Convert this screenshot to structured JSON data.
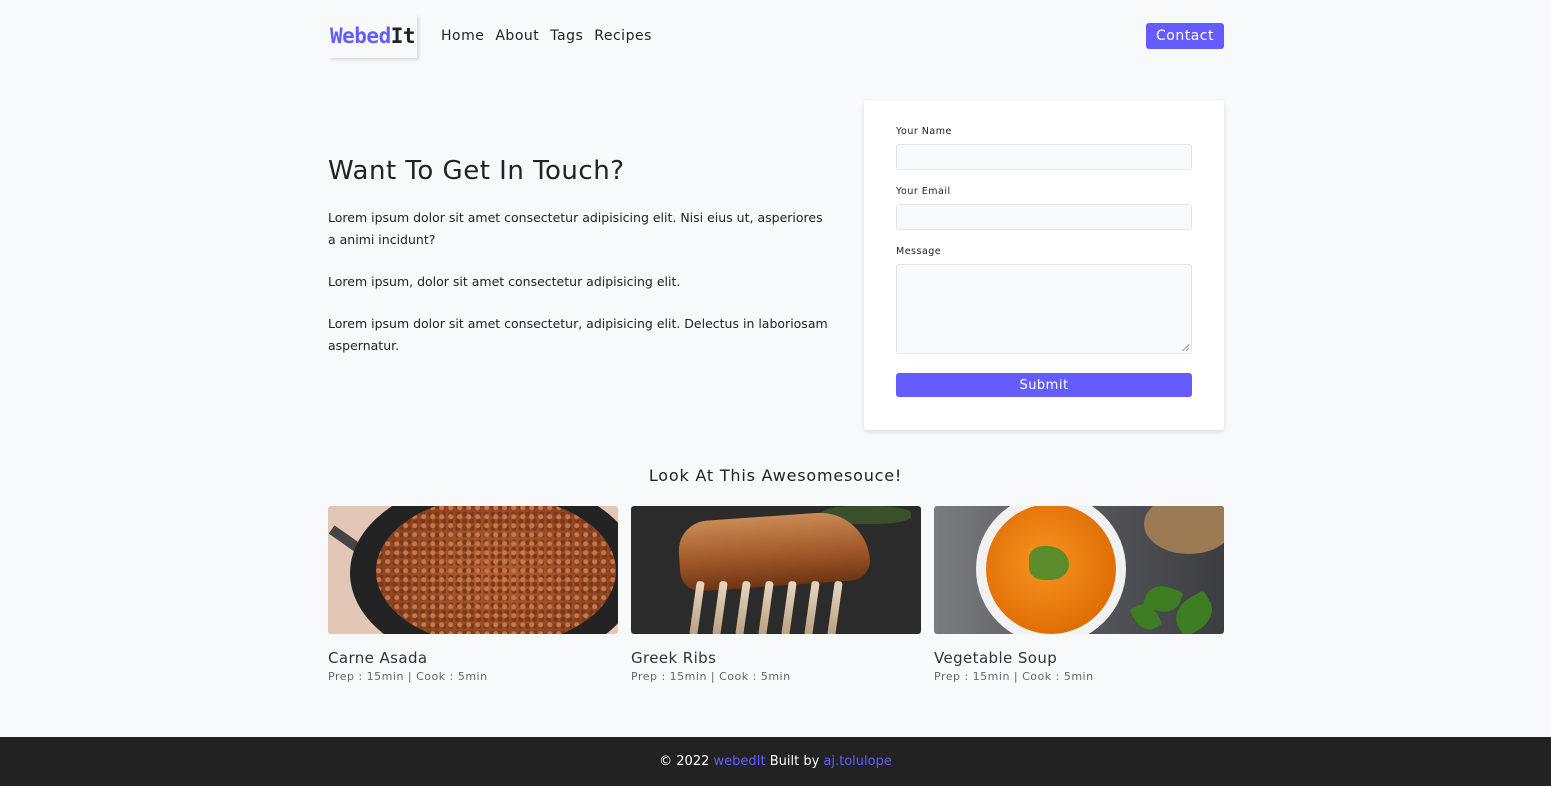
{
  "nav": {
    "logo_part1": "Webed",
    "logo_part2": "It",
    "links": [
      "Home",
      "About",
      "Tags",
      "Recipes"
    ],
    "contact_label": "Contact",
    "accent_color": "#645cff"
  },
  "hero": {
    "title": "Want To Get In Touch?",
    "paragraphs": [
      "Lorem ipsum dolor sit amet consectetur adipisicing elit. Nisi eius ut, asperiores a animi incidunt?",
      "Lorem ipsum, dolor sit amet consectetur adipisicing elit.",
      "Lorem ipsum dolor sit amet consectetur, adipisicing elit. Delectus in laboriosam aspernatur."
    ]
  },
  "form": {
    "name_label": "Your Name",
    "name_value": "",
    "email_label": "Your Email",
    "email_value": "",
    "message_label": "Message",
    "message_value": "",
    "submit_label": "Submit"
  },
  "featured": {
    "title": "Look At This Awesomesouce!",
    "recipes": [
      {
        "name": "Carne Asada",
        "meta": "Prep : 15min | Cook : 5min",
        "image_icon": "carne-asada-image"
      },
      {
        "name": "Greek Ribs",
        "meta": "Prep : 15min | Cook : 5min",
        "image_icon": "greek-ribs-image"
      },
      {
        "name": "Vegetable Soup",
        "meta": "Prep : 15min | Cook : 5min",
        "image_icon": "vegetable-soup-image"
      }
    ]
  },
  "footer": {
    "copyright": "© 2022",
    "brand": "webedIt",
    "built_by": "Built by",
    "author": "aj.tolulope",
    "background": "#222222"
  }
}
